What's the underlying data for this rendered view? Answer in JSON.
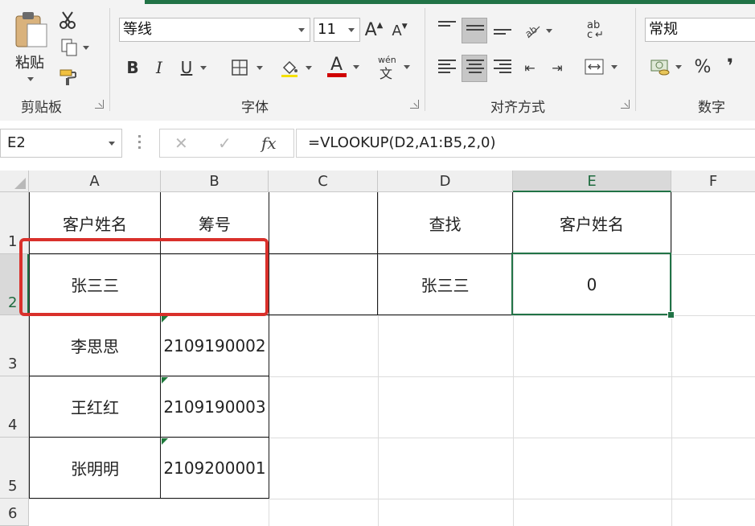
{
  "ribbon": {
    "clipboard": {
      "paste_label": "粘贴",
      "group_label": "剪贴板"
    },
    "font": {
      "font_name": "等线",
      "font_size": "11",
      "bold": "B",
      "italic": "I",
      "underline": "U",
      "font_color_glyph": "A",
      "phonetic_glyph": "wén",
      "phonetic_glyph2": "文",
      "grow_glyph": "A",
      "shrink_glyph": "A",
      "group_label": "字体"
    },
    "alignment": {
      "group_label": "对齐方式",
      "wrap_glyph": "ab",
      "wrap_glyph2": "c"
    },
    "number": {
      "format": "常规",
      "percent": "%",
      "comma": "❜",
      "group_label": "数字"
    }
  },
  "formula_bar": {
    "name_box": "E2",
    "cancel_glyph": "✕",
    "enter_glyph": "✓",
    "fx_label": "fx",
    "formula": "=VLOOKUP(D2,A1:B5,2,0)"
  },
  "grid": {
    "columns": [
      "A",
      "B",
      "C",
      "D",
      "E",
      "F"
    ],
    "rows": [
      "1",
      "2",
      "3",
      "4",
      "5",
      "6"
    ],
    "cells": {
      "A1": "客户姓名",
      "B1": "筹号",
      "A2": "张三三",
      "B2": "",
      "A3": "李思思",
      "B3": "2109190002",
      "A4": "王红红",
      "B4": "2109190003",
      "A5": "张明明",
      "B5": "2109200001",
      "D1": "查找",
      "E1": "客户姓名",
      "D2": "张三三",
      "E2": "0"
    }
  },
  "colors": {
    "accent": "#217346",
    "highlight_box": "#d9302b",
    "font_color_bar": "#d00000"
  }
}
